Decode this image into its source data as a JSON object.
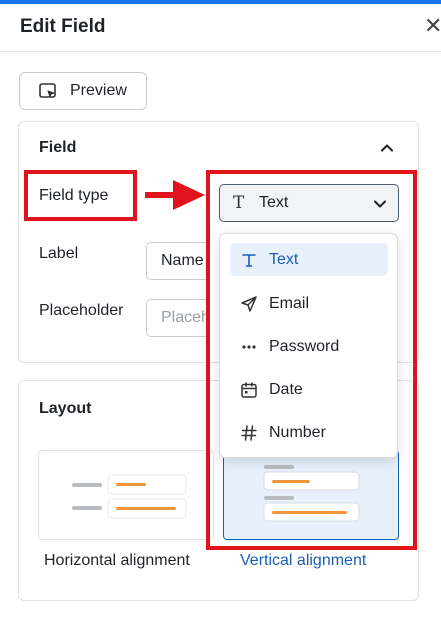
{
  "dialog": {
    "title": "Edit Field",
    "close_glyph": "✕"
  },
  "preview_button": {
    "label": "Preview"
  },
  "field_section": {
    "title": "Field",
    "field_type_label": "Field type",
    "field_type_value": "Text",
    "label_label": "Label",
    "label_value": "Name",
    "placeholder_label": "Placeholder",
    "placeholder_value": "Placeholder"
  },
  "dropdown": {
    "items": [
      {
        "label": "Text",
        "icon": "text-type-icon",
        "selected": true
      },
      {
        "label": "Email",
        "icon": "send-icon",
        "selected": false
      },
      {
        "label": "Password",
        "icon": "dots-icon",
        "selected": false
      },
      {
        "label": "Date",
        "icon": "calendar-icon",
        "selected": false
      },
      {
        "label": "Number",
        "icon": "hash-icon",
        "selected": false
      }
    ]
  },
  "layout_section": {
    "title": "Layout",
    "options": [
      {
        "label": "Horizontal alignment",
        "selected": false
      },
      {
        "label": "Vertical alignment",
        "selected": true
      }
    ]
  },
  "colors": {
    "accent": "#1a5fb4",
    "highlight": "#e0121b",
    "top_bar": "#1a73e8",
    "orange": "#f0953a"
  }
}
